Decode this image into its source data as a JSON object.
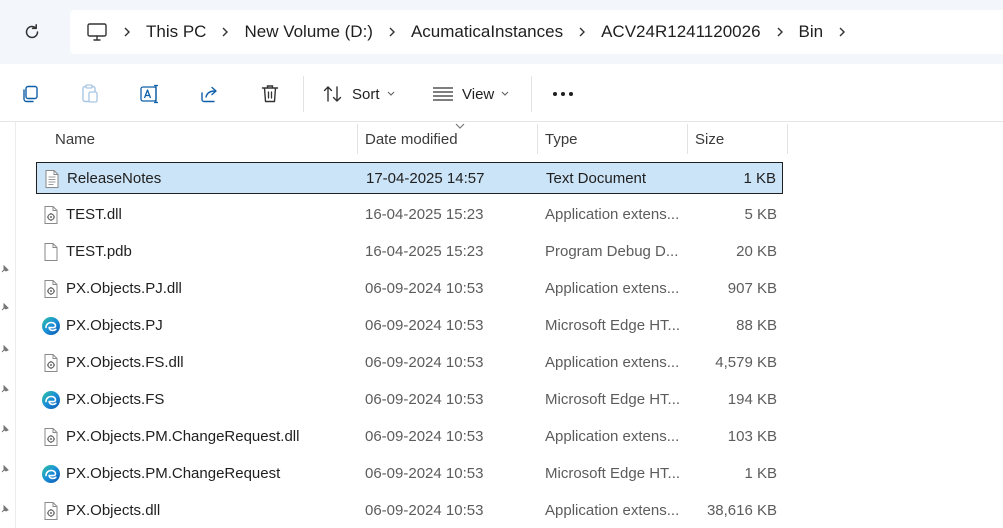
{
  "breadcrumb": {
    "items": [
      "This PC",
      "New Volume (D:)",
      "AcumaticaInstances",
      "ACV24R1241120026",
      "Bin"
    ]
  },
  "toolbar": {
    "sort_label": "Sort",
    "view_label": "View"
  },
  "columns": {
    "name": "Name",
    "date": "Date modified",
    "type": "Type",
    "size": "Size"
  },
  "files": [
    {
      "name": "ReleaseNotes",
      "date": "17-04-2025 14:57",
      "type": "Text Document",
      "size": "1 KB",
      "icon": "text-file-icon"
    },
    {
      "name": "TEST.dll",
      "date": "16-04-2025 15:23",
      "type": "Application extens...",
      "size": "5 KB",
      "icon": "dll-file-icon"
    },
    {
      "name": "TEST.pdb",
      "date": "16-04-2025 15:23",
      "type": "Program Debug D...",
      "size": "20 KB",
      "icon": "blank-file-icon"
    },
    {
      "name": "PX.Objects.PJ.dll",
      "date": "06-09-2024 10:53",
      "type": "Application extens...",
      "size": "907 KB",
      "icon": "dll-file-icon"
    },
    {
      "name": "PX.Objects.PJ",
      "date": "06-09-2024 10:53",
      "type": "Microsoft Edge HT...",
      "size": "88 KB",
      "icon": "edge-icon"
    },
    {
      "name": "PX.Objects.FS.dll",
      "date": "06-09-2024 10:53",
      "type": "Application extens...",
      "size": "4,579 KB",
      "icon": "dll-file-icon"
    },
    {
      "name": "PX.Objects.FS",
      "date": "06-09-2024 10:53",
      "type": "Microsoft Edge HT...",
      "size": "194 KB",
      "icon": "edge-icon"
    },
    {
      "name": "PX.Objects.PM.ChangeRequest.dll",
      "date": "06-09-2024 10:53",
      "type": "Application extens...",
      "size": "103 KB",
      "icon": "dll-file-icon"
    },
    {
      "name": "PX.Objects.PM.ChangeRequest",
      "date": "06-09-2024 10:53",
      "type": "Microsoft Edge HT...",
      "size": "1 KB",
      "icon": "edge-icon"
    },
    {
      "name": "PX.Objects.dll",
      "date": "06-09-2024 10:53",
      "type": "Application extens...",
      "size": "38,616 KB",
      "icon": "dll-file-icon"
    }
  ],
  "colors": {
    "selection_bg": "#cce4f7",
    "accent": "#005fb8",
    "addressbar_bg": "#f3f6fb"
  }
}
